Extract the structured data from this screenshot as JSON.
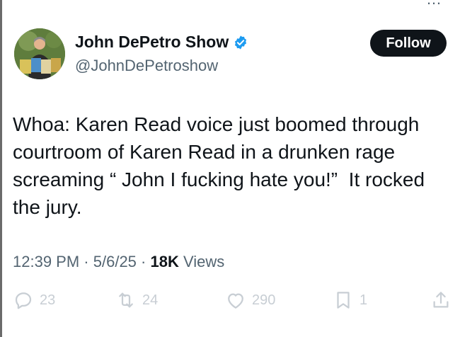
{
  "tweet": {
    "author": {
      "display_name": "John DePetro Show",
      "handle": "@JohnDePetroshow",
      "verified_color": "#1d9bf0"
    },
    "follow_label": "Follow",
    "text": "Whoa: Karen Read voice just boomed through\ncourtroom of Karen Read in a drunken rage\nscreaming “ John I fucking hate you!”  It rocked\nthe jury.",
    "meta": {
      "time": "12:39 PM",
      "separator": "·",
      "date": "5/6/25",
      "views_count": "18K",
      "views_label": "Views"
    },
    "actions": {
      "replies": "23",
      "retweets": "24",
      "likes": "290",
      "bookmarks": "1"
    },
    "icons": [
      "more-icon",
      "verified-badge-icon",
      "reply-icon",
      "retweet-icon",
      "like-icon",
      "bookmark-icon",
      "share-icon"
    ]
  }
}
